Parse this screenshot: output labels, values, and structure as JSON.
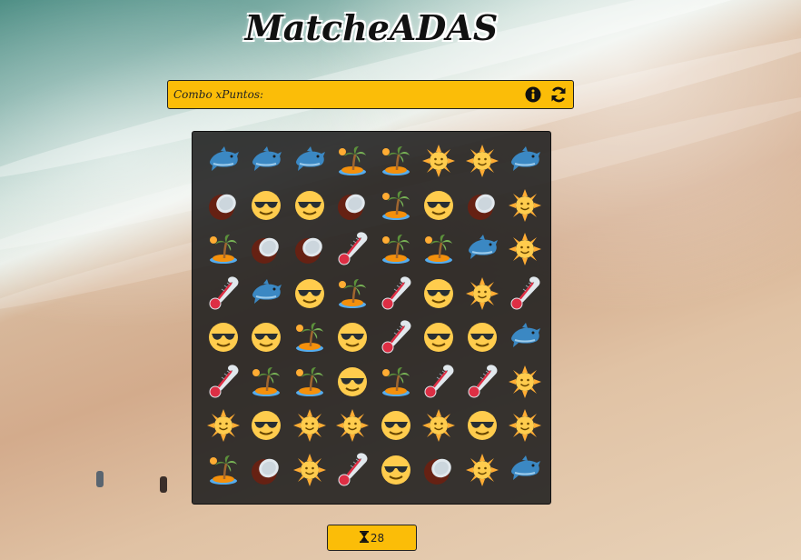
{
  "title": "MatcheADAS",
  "combo": {
    "label": "Combo xPuntos:",
    "info_icon": "info-circle-icon",
    "refresh_icon": "refresh-icon"
  },
  "timer": {
    "icon": "hourglass-icon",
    "value": "28"
  },
  "colors": {
    "accent": "#fbbd08",
    "board_bg": "#2a2a2a"
  },
  "board": {
    "rows": [
      [
        "dolphin",
        "dolphin",
        "dolphin",
        "island",
        "island",
        "sun",
        "sun",
        "dolphin"
      ],
      [
        "coconut",
        "sunglasses",
        "sunglasses",
        "coconut",
        "island",
        "sunglasses",
        "coconut",
        "sun"
      ],
      [
        "island",
        "coconut",
        "coconut",
        "thermometer",
        "island",
        "island",
        "dolphin",
        "sun"
      ],
      [
        "thermometer",
        "dolphin",
        "sunglasses",
        "island",
        "thermometer",
        "sunglasses",
        "sun",
        "thermometer"
      ],
      [
        "sunglasses",
        "sunglasses",
        "island",
        "sunglasses",
        "thermometer",
        "sunglasses",
        "sunglasses",
        "dolphin"
      ],
      [
        "thermometer",
        "island",
        "island",
        "sunglasses",
        "island",
        "thermometer",
        "thermometer",
        "sun"
      ],
      [
        "sun",
        "sunglasses",
        "sun",
        "sun",
        "sunglasses",
        "sun",
        "sunglasses",
        "sun"
      ],
      [
        "island",
        "coconut",
        "sun",
        "thermometer",
        "sunglasses",
        "coconut",
        "sun",
        "dolphin"
      ]
    ]
  }
}
